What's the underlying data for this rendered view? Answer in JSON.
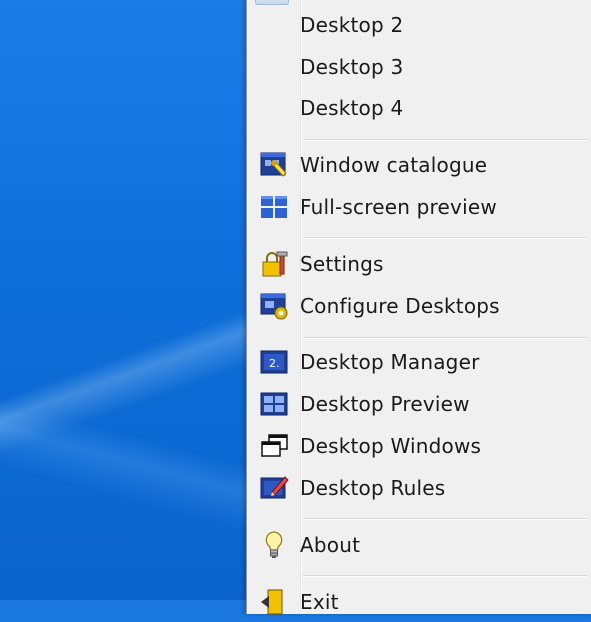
{
  "menu": {
    "desktop_items": [
      {
        "label": "Desktop 2"
      },
      {
        "label": "Desktop 3"
      },
      {
        "label": "Desktop 4"
      }
    ],
    "group_preview": [
      {
        "label": "Window catalogue",
        "icon": "window-catalogue-icon"
      },
      {
        "label": "Full-screen preview",
        "icon": "full-screen-preview-icon"
      }
    ],
    "group_settings": [
      {
        "label": "Settings",
        "icon": "settings-icon"
      },
      {
        "label": "Configure Desktops",
        "icon": "configure-desktops-icon"
      }
    ],
    "group_desktop": [
      {
        "label": "Desktop Manager",
        "icon": "desktop-manager-icon"
      },
      {
        "label": "Desktop Preview",
        "icon": "desktop-preview-icon"
      },
      {
        "label": "Desktop Windows",
        "icon": "desktop-windows-icon"
      },
      {
        "label": "Desktop Rules",
        "icon": "desktop-rules-icon"
      }
    ],
    "about": {
      "label": "About",
      "icon": "lightbulb-icon"
    },
    "exit": {
      "label": "Exit",
      "icon": "exit-icon"
    }
  },
  "colors": {
    "desktop_blue": "#1a78e0",
    "menu_bg": "#f0f0f0",
    "icon_blue": "#1e56b8",
    "icon_yellow": "#f2c200"
  }
}
